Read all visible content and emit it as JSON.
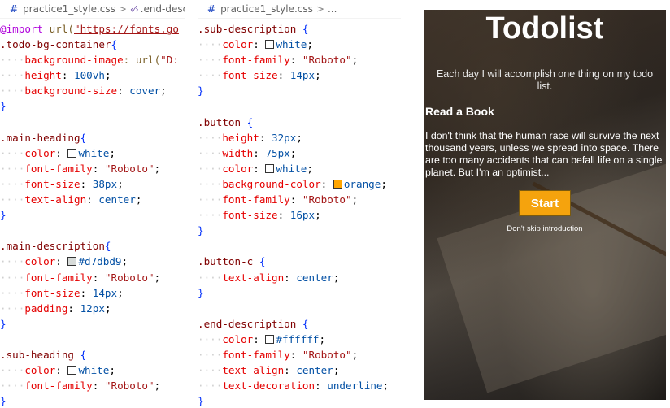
{
  "editor_left": {
    "tab": {
      "hash": "#",
      "file": "practice1_style.css",
      "separator": ">",
      "symbol_icon": "css-selector-icon",
      "symbol": ".end-desci"
    },
    "lines": [
      [
        {
          "t": "@import",
          "c": "at"
        },
        {
          "t": " url(",
          "c": "fn"
        },
        {
          "t": "\"https://fonts.go",
          "c": "url"
        }
      ],
      [
        {
          "t": ".todo-bg-container",
          "c": "sel"
        },
        {
          "t": "{",
          "c": "brace"
        }
      ],
      [
        {
          "t": "····",
          "c": "ws"
        },
        {
          "t": "background-image",
          "c": "prop"
        },
        {
          "t": ": url(",
          "c": "fn"
        },
        {
          "t": "\"D:",
          "c": "str"
        }
      ],
      [
        {
          "t": "····",
          "c": "ws"
        },
        {
          "t": "height",
          "c": "prop"
        },
        {
          "t": ": "
        },
        {
          "t": "100vh",
          "c": "val"
        },
        {
          "t": ";"
        }
      ],
      [
        {
          "t": "····",
          "c": "ws"
        },
        {
          "t": "background-size",
          "c": "prop"
        },
        {
          "t": ": "
        },
        {
          "t": "cover",
          "c": "val"
        },
        {
          "t": ";"
        }
      ],
      [
        {
          "t": "}",
          "c": "brace"
        }
      ],
      [],
      [
        {
          "t": ".main-heading",
          "c": "sel"
        },
        {
          "t": "{",
          "c": "brace"
        }
      ],
      [
        {
          "t": "····",
          "c": "ws"
        },
        {
          "t": "color",
          "c": "prop"
        },
        {
          "t": ": "
        },
        {
          "swatch": "#ffffff"
        },
        {
          "t": "white",
          "c": "val"
        },
        {
          "t": ";"
        }
      ],
      [
        {
          "t": "····",
          "c": "ws"
        },
        {
          "t": "font-family",
          "c": "prop"
        },
        {
          "t": ": "
        },
        {
          "t": "\"Roboto\"",
          "c": "str"
        },
        {
          "t": ";"
        }
      ],
      [
        {
          "t": "····",
          "c": "ws"
        },
        {
          "t": "font-size",
          "c": "prop"
        },
        {
          "t": ": "
        },
        {
          "t": "38px",
          "c": "val"
        },
        {
          "t": ";"
        }
      ],
      [
        {
          "t": "····",
          "c": "ws"
        },
        {
          "t": "text-align",
          "c": "prop"
        },
        {
          "t": ": "
        },
        {
          "t": "center",
          "c": "val"
        },
        {
          "t": ";"
        }
      ],
      [
        {
          "t": "}",
          "c": "brace"
        }
      ],
      [],
      [
        {
          "t": ".main-description",
          "c": "sel"
        },
        {
          "t": "{",
          "c": "brace"
        }
      ],
      [
        {
          "t": "····",
          "c": "ws"
        },
        {
          "t": "color",
          "c": "prop"
        },
        {
          "t": ": "
        },
        {
          "swatch": "#d7dbd9"
        },
        {
          "t": "#d7dbd9",
          "c": "val"
        },
        {
          "t": ";"
        }
      ],
      [
        {
          "t": "····",
          "c": "ws"
        },
        {
          "t": "font-family",
          "c": "prop"
        },
        {
          "t": ": "
        },
        {
          "t": "\"Roboto\"",
          "c": "str"
        },
        {
          "t": ";"
        }
      ],
      [
        {
          "t": "····",
          "c": "ws"
        },
        {
          "t": "font-size",
          "c": "prop"
        },
        {
          "t": ": "
        },
        {
          "t": "14px",
          "c": "val"
        },
        {
          "t": ";"
        }
      ],
      [
        {
          "t": "····",
          "c": "ws"
        },
        {
          "t": "padding",
          "c": "prop"
        },
        {
          "t": ": "
        },
        {
          "t": "12px",
          "c": "val"
        },
        {
          "t": ";"
        }
      ],
      [
        {
          "t": "}",
          "c": "brace"
        }
      ],
      [],
      [
        {
          "t": ".sub-heading",
          "c": "sel"
        },
        {
          "t": " {",
          "c": "brace"
        }
      ],
      [
        {
          "t": "····",
          "c": "ws"
        },
        {
          "t": "color",
          "c": "prop"
        },
        {
          "t": ": "
        },
        {
          "swatch": "#ffffff"
        },
        {
          "t": "white",
          "c": "val"
        },
        {
          "t": ";"
        }
      ],
      [
        {
          "t": "····",
          "c": "ws"
        },
        {
          "t": "font-family",
          "c": "prop"
        },
        {
          "t": ": "
        },
        {
          "t": "\"Roboto\"",
          "c": "str"
        },
        {
          "t": ";"
        }
      ],
      [
        {
          "t": "}",
          "c": "brace"
        }
      ]
    ]
  },
  "editor_right": {
    "tab": {
      "hash": "#",
      "file": "practice1_style.css",
      "separator": ">",
      "symbol": "..."
    },
    "lines": [
      [
        {
          "t": ".sub-description",
          "c": "sel"
        },
        {
          "t": " {",
          "c": "brace"
        }
      ],
      [
        {
          "t": "····",
          "c": "ws"
        },
        {
          "t": "color",
          "c": "prop"
        },
        {
          "t": ": "
        },
        {
          "swatch": "#ffffff"
        },
        {
          "t": "white",
          "c": "val"
        },
        {
          "t": ";"
        }
      ],
      [
        {
          "t": "····",
          "c": "ws"
        },
        {
          "t": "font-family",
          "c": "prop"
        },
        {
          "t": ": "
        },
        {
          "t": "\"Roboto\"",
          "c": "str"
        },
        {
          "t": ";"
        }
      ],
      [
        {
          "t": "····",
          "c": "ws"
        },
        {
          "t": "font-size",
          "c": "prop"
        },
        {
          "t": ": "
        },
        {
          "t": "14px",
          "c": "val"
        },
        {
          "t": ";"
        }
      ],
      [
        {
          "t": "}",
          "c": "brace"
        }
      ],
      [],
      [
        {
          "t": ".button",
          "c": "sel"
        },
        {
          "t": " {",
          "c": "brace"
        }
      ],
      [
        {
          "t": "····",
          "c": "ws"
        },
        {
          "t": "height",
          "c": "prop"
        },
        {
          "t": ": "
        },
        {
          "t": "32px",
          "c": "val"
        },
        {
          "t": ";"
        }
      ],
      [
        {
          "t": "····",
          "c": "ws"
        },
        {
          "t": "width",
          "c": "prop"
        },
        {
          "t": ": "
        },
        {
          "t": "75px",
          "c": "val"
        },
        {
          "t": ";"
        }
      ],
      [
        {
          "t": "····",
          "c": "ws"
        },
        {
          "t": "color",
          "c": "prop"
        },
        {
          "t": ": "
        },
        {
          "swatch": "#ffffff"
        },
        {
          "t": "white",
          "c": "val"
        },
        {
          "t": ";"
        }
      ],
      [
        {
          "t": "····",
          "c": "ws"
        },
        {
          "t": "background-color",
          "c": "prop"
        },
        {
          "t": ": "
        },
        {
          "swatch": "#ffa500"
        },
        {
          "t": "orange",
          "c": "val"
        },
        {
          "t": ";"
        }
      ],
      [
        {
          "t": "····",
          "c": "ws"
        },
        {
          "t": "font-family",
          "c": "prop"
        },
        {
          "t": ": "
        },
        {
          "t": "\"Roboto\"",
          "c": "str"
        },
        {
          "t": ";"
        }
      ],
      [
        {
          "t": "····",
          "c": "ws"
        },
        {
          "t": "font-size",
          "c": "prop"
        },
        {
          "t": ": "
        },
        {
          "t": "16px",
          "c": "val"
        },
        {
          "t": ";"
        }
      ],
      [
        {
          "t": "}",
          "c": "brace"
        }
      ],
      [],
      [
        {
          "t": ".button-c",
          "c": "sel"
        },
        {
          "t": " {",
          "c": "brace"
        }
      ],
      [
        {
          "t": "····",
          "c": "ws"
        },
        {
          "t": "text-align",
          "c": "prop"
        },
        {
          "t": ": "
        },
        {
          "t": "center",
          "c": "val"
        },
        {
          "t": ";"
        }
      ],
      [
        {
          "t": "}",
          "c": "brace"
        }
      ],
      [],
      [
        {
          "t": ".end-description",
          "c": "sel"
        },
        {
          "t": " {",
          "c": "brace"
        }
      ],
      [
        {
          "t": "····",
          "c": "ws"
        },
        {
          "t": "color",
          "c": "prop"
        },
        {
          "t": ": "
        },
        {
          "swatch": "#ffffff"
        },
        {
          "t": "#ffffff",
          "c": "val"
        },
        {
          "t": ";"
        }
      ],
      [
        {
          "t": "····",
          "c": "ws"
        },
        {
          "t": "font-family",
          "c": "prop"
        },
        {
          "t": ": "
        },
        {
          "t": "\"Roboto\"",
          "c": "str"
        },
        {
          "t": ";"
        }
      ],
      [
        {
          "t": "····",
          "c": "ws"
        },
        {
          "t": "text-align",
          "c": "prop"
        },
        {
          "t": ": "
        },
        {
          "t": "center",
          "c": "val"
        },
        {
          "t": ";"
        }
      ],
      [
        {
          "t": "····",
          "c": "ws"
        },
        {
          "t": "text-decoration",
          "c": "prop"
        },
        {
          "t": ": "
        },
        {
          "t": "underline",
          "c": "val"
        },
        {
          "t": ";"
        }
      ],
      [
        {
          "t": "}",
          "c": "brace"
        }
      ]
    ]
  },
  "preview": {
    "title": "Todolist",
    "description": "Each day I will accomplish one thing on my todo list.",
    "sub_heading": "Read a Book",
    "sub_description": "I don't think that the human race will survive the next thousand years, unless we spread into space. There are too many accidents that can befall life on a single planet. But I'm an optimist...",
    "button_label": "Start",
    "end_description": "Don't skip introduction",
    "colors": {
      "button": "#f5a30d",
      "text": "#ffffff"
    }
  }
}
